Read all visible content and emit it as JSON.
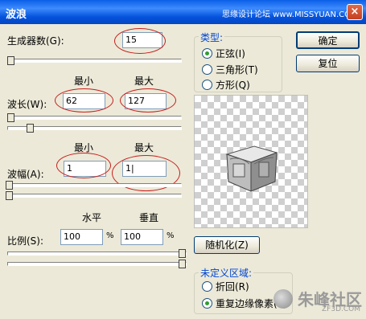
{
  "window": {
    "title": "波浪",
    "watermark": "思缘设计论坛 www.MISSYUAN.COM",
    "close_glyph": "×"
  },
  "generators": {
    "label": "生成器数(G):",
    "value": "15"
  },
  "minmax": {
    "min": "最小",
    "max": "最大"
  },
  "wavelength": {
    "label": "波长(W):",
    "min": "62",
    "max": "127"
  },
  "amplitude": {
    "label": "波幅(A):",
    "min": "1",
    "max": "1|"
  },
  "scale": {
    "label": "比例(S):",
    "horizontal": "水平",
    "vertical": "垂直",
    "h_value": "100",
    "v_value": "100",
    "unit": "%"
  },
  "type_group": {
    "title": "类型:",
    "options": [
      {
        "label": "正弦(I)",
        "selected": true
      },
      {
        "label": "三角形(T)",
        "selected": false
      },
      {
        "label": "方形(Q)",
        "selected": false
      }
    ]
  },
  "buttons": {
    "ok": "确定",
    "reset": "复位",
    "randomize": "随机化(Z)"
  },
  "undefined_area": {
    "title": "未定义区域:",
    "options": [
      {
        "label": "折回(R)",
        "selected": false
      },
      {
        "label": "重复边缘像素(E)",
        "selected": true
      }
    ]
  },
  "logo": {
    "text": "朱峰社区",
    "sub": "ZF3D.COM"
  }
}
